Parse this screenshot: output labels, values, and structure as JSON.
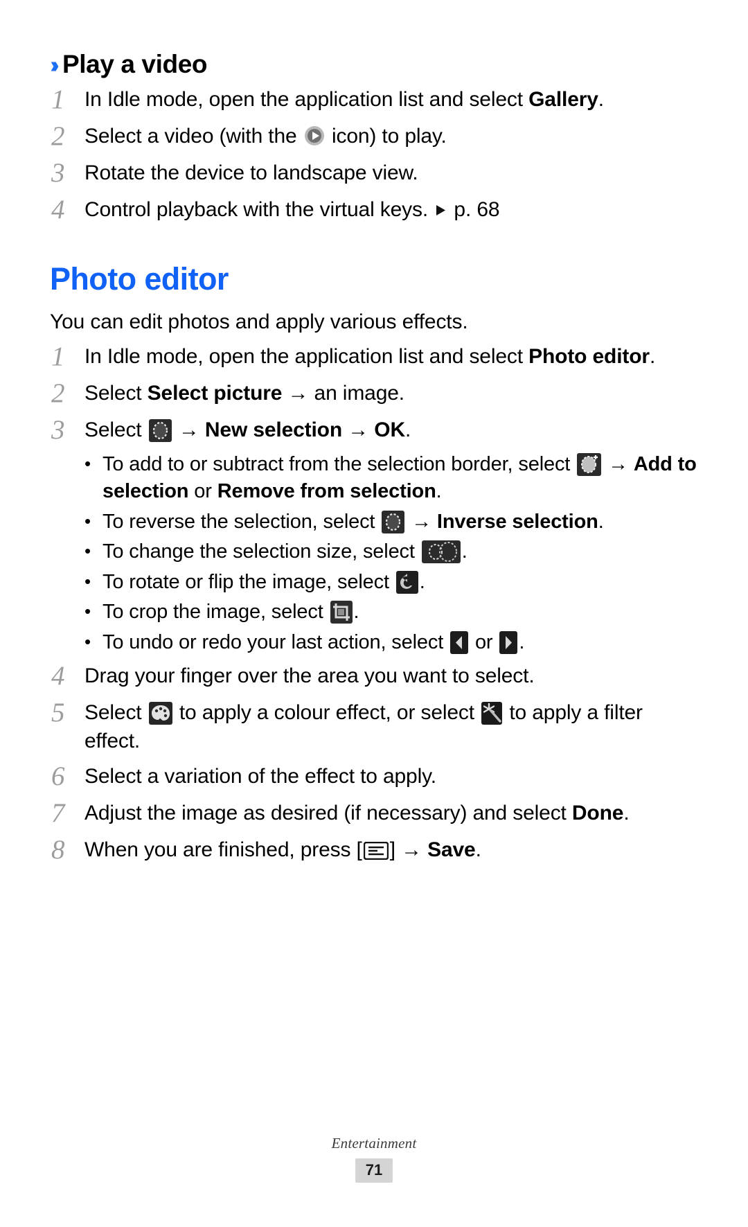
{
  "document": {
    "section_heading": "Play a video",
    "section_heading_marker": "››",
    "main_heading": "Photo editor",
    "intro": "You can edit photos and apply various effects.",
    "accent_color": "#1061f5"
  },
  "play_video_steps": [
    {
      "number": "1",
      "parts": [
        {
          "type": "text",
          "text": "In Idle mode, open the application list and select "
        },
        {
          "type": "bold",
          "text": "Gallery"
        },
        {
          "type": "text",
          "text": "."
        }
      ]
    },
    {
      "number": "2",
      "parts": [
        {
          "type": "text",
          "text": "Select a video (with the "
        },
        {
          "type": "icon",
          "icon": "play-circle-icon"
        },
        {
          "type": "text",
          "text": " icon) to play."
        }
      ]
    },
    {
      "number": "3",
      "parts": [
        {
          "type": "text",
          "text": "Rotate the device to landscape view."
        }
      ]
    },
    {
      "number": "4",
      "parts": [
        {
          "type": "text",
          "text": "Control playback with the virtual keys. "
        },
        {
          "type": "icon",
          "icon": "triangle-right-icon"
        },
        {
          "type": "text",
          "text": " p. 68"
        }
      ]
    }
  ],
  "photo_editor_steps": [
    {
      "number": "1",
      "parts": [
        {
          "type": "text",
          "text": "In Idle mode, open the application list and select "
        },
        {
          "type": "bold",
          "text": "Photo editor"
        },
        {
          "type": "text",
          "text": "."
        }
      ]
    },
    {
      "number": "2",
      "parts": [
        {
          "type": "text",
          "text": "Select "
        },
        {
          "type": "bold",
          "text": "Select picture"
        },
        {
          "type": "text",
          "text": " → an image."
        }
      ]
    },
    {
      "number": "3",
      "parts": [
        {
          "type": "text",
          "text": "Select "
        },
        {
          "type": "icon",
          "icon": "selection-circle-icon"
        },
        {
          "type": "text",
          "text": " → "
        },
        {
          "type": "bold",
          "text": "New selection"
        },
        {
          "type": "text",
          "text": " → "
        },
        {
          "type": "bold",
          "text": "OK"
        },
        {
          "type": "text",
          "text": "."
        }
      ]
    },
    {
      "number": "4",
      "parts": [
        {
          "type": "text",
          "text": "Drag your finger over the area you want to select."
        }
      ]
    },
    {
      "number": "5",
      "parts": [
        {
          "type": "text",
          "text": "Select "
        },
        {
          "type": "icon",
          "icon": "colour-palette-icon"
        },
        {
          "type": "text",
          "text": " to apply a colour effect, or select "
        },
        {
          "type": "icon",
          "icon": "magic-wand-icon"
        },
        {
          "type": "text",
          "text": " to apply a filter effect."
        }
      ]
    },
    {
      "number": "6",
      "parts": [
        {
          "type": "text",
          "text": "Select a variation of the effect to apply."
        }
      ]
    },
    {
      "number": "7",
      "parts": [
        {
          "type": "text",
          "text": "Adjust the image as desired (if necessary) and select "
        },
        {
          "type": "bold",
          "text": "Done"
        },
        {
          "type": "text",
          "text": "."
        }
      ]
    },
    {
      "number": "8",
      "parts": [
        {
          "type": "text",
          "text": "When you are finished, press ["
        },
        {
          "type": "icon",
          "icon": "menu-key-icon"
        },
        {
          "type": "text",
          "text": "] → "
        },
        {
          "type": "bold",
          "text": "Save"
        },
        {
          "type": "text",
          "text": "."
        }
      ]
    }
  ],
  "photo_editor_bullets": [
    {
      "parts": [
        {
          "type": "text",
          "text": "To add to or subtract from the selection border, select "
        },
        {
          "type": "icon",
          "icon": "add-selection-icon"
        },
        {
          "type": "text",
          "text": " → "
        },
        {
          "type": "bold",
          "text": "Add to selection"
        },
        {
          "type": "text",
          "text": " or "
        },
        {
          "type": "bold",
          "text": "Remove from selection"
        },
        {
          "type": "text",
          "text": "."
        }
      ]
    },
    {
      "parts": [
        {
          "type": "text",
          "text": "To reverse the selection, select "
        },
        {
          "type": "icon",
          "icon": "selection-circle-icon"
        },
        {
          "type": "text",
          "text": " → "
        },
        {
          "type": "bold",
          "text": "Inverse selection"
        },
        {
          "type": "text",
          "text": "."
        }
      ]
    },
    {
      "parts": [
        {
          "type": "text",
          "text": "To change the selection size, select "
        },
        {
          "type": "icon",
          "icon": "selection-size-icon"
        },
        {
          "type": "text",
          "text": "."
        }
      ]
    },
    {
      "parts": [
        {
          "type": "text",
          "text": "To rotate or flip the image, select "
        },
        {
          "type": "icon",
          "icon": "rotate-flip-icon"
        },
        {
          "type": "text",
          "text": "."
        }
      ]
    },
    {
      "parts": [
        {
          "type": "text",
          "text": "To crop the image, select "
        },
        {
          "type": "icon",
          "icon": "crop-icon"
        },
        {
          "type": "text",
          "text": "."
        }
      ]
    },
    {
      "parts": [
        {
          "type": "text",
          "text": "To undo or redo your last action, select "
        },
        {
          "type": "icon",
          "icon": "undo-arrow-icon"
        },
        {
          "type": "text",
          "text": " or "
        },
        {
          "type": "icon",
          "icon": "redo-arrow-icon"
        },
        {
          "type": "text",
          "text": "."
        }
      ]
    }
  ],
  "footer": {
    "label": "Entertainment",
    "page_number": "71"
  }
}
